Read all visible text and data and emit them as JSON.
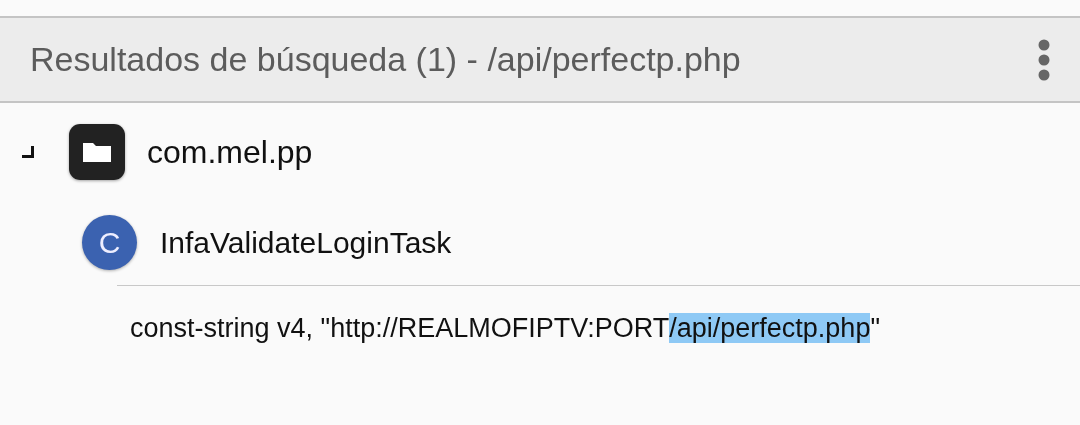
{
  "header": {
    "title": "Resultados de búsqueda (1) - /api/perfectp.php"
  },
  "results": [
    {
      "kind": "package",
      "label": "com.mel.pp",
      "expanded": true,
      "children": [
        {
          "kind": "class",
          "badge": "C",
          "label": "InfaValidateLoginTask",
          "children": [
            {
              "kind": "match",
              "text_before": "const-string v4, \"http://REALMOFIPTV:PORT",
              "highlight": "/api/perfectp.php",
              "text_after": "\""
            }
          ]
        }
      ]
    }
  ]
}
